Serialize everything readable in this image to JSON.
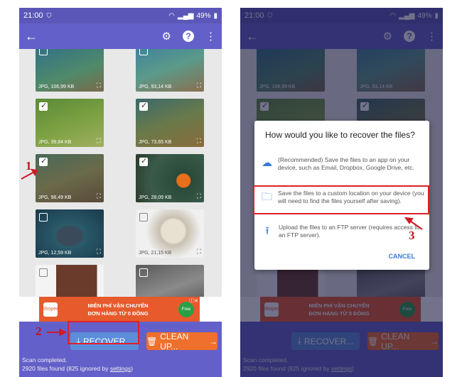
{
  "status_bar": {
    "time": "21:00",
    "battery": "49%"
  },
  "thumbnails": [
    {
      "meta": "JPG, 106,99 KB",
      "checked": false
    },
    {
      "meta": "JPG, 93,14 KB",
      "checked": false
    },
    {
      "meta": "JPG, 39,84 KB",
      "checked": true
    },
    {
      "meta": "JPG, 73,65 KB",
      "checked": true
    },
    {
      "meta": "JPG, 98,49 KB",
      "checked": true
    },
    {
      "meta": "JPG, 28,09 KB",
      "checked": true
    },
    {
      "meta": "JPG, 12,59 KB",
      "checked": false
    },
    {
      "meta": "JPG, 21,15 KB",
      "checked": false
    },
    {
      "meta": "",
      "checked": false
    },
    {
      "meta": "",
      "checked": false
    }
  ],
  "ad": {
    "line1": "MIỄN PHÍ VẬN CHUYỂN",
    "line2": "ĐƠN HÀNG TỪ 0 ĐỒNG",
    "brand": "Shopee",
    "badge": "Free"
  },
  "buttons": {
    "recover": "RECOVER...",
    "cleanup": "CLEAN UP..."
  },
  "status": {
    "line1": "Scan completed.",
    "line2_prefix": "2920 files found (825 ignored by ",
    "line2_link": "settings",
    "line2_suffix": ")"
  },
  "dialog": {
    "title": "How would you like to recover the files?",
    "options": [
      {
        "icon": "cloud-upload-icon",
        "text": "(Recommended) Save the files to an app on your device, such as Email, Dropbox, Google Drive, etc."
      },
      {
        "icon": "folder-icon",
        "text": "Save the files to a custom location on your device (you will need to find the files yourself after saving)."
      },
      {
        "icon": "upload-icon",
        "text": "Upload the files to an FTP server (requires access to an FTP server)."
      }
    ],
    "cancel": "CANCEL"
  },
  "annotations": {
    "step1": "1",
    "step2": "2",
    "step3": "3"
  },
  "colors": {
    "appbar": "#6360c9",
    "recover_button": "#5b8dd9",
    "cleanup_button": "#ef6f2c",
    "annotation_red": "#e0202a"
  }
}
